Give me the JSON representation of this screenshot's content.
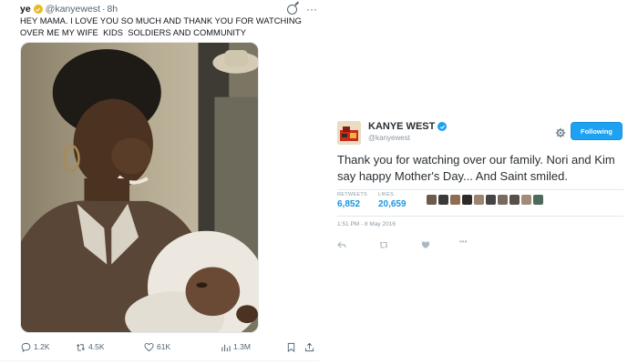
{
  "tweet": {
    "display_name": "ye",
    "handle": "@kanyewest",
    "separator": "·",
    "time": "8h",
    "more": "···",
    "text_line1": "HEY MAMA. I LOVE YOU SO MUCH AND THANK YOU FOR WATCHING",
    "text_line2": "OVER ME MY WIFE  KIDS  SOLDIERS AND COMMUNITY",
    "actions": {
      "replies": "1.2K",
      "reposts": "4.5K",
      "likes": "61K",
      "views": "1.3M"
    }
  },
  "embed": {
    "name": "KANYE WEST",
    "handle": "@kanyewest",
    "follow_label": "Following",
    "text": "Thank you for watching over our family. Nori and Kim say happy Mother's Day... And Saint smiled.",
    "retweets_label": "RETWEETS",
    "retweets_value": "6,852",
    "likes_label": "LIKES",
    "likes_value": "20,659",
    "timestamp": "1:51 PM - 8 May 2016",
    "more": "•••"
  },
  "colors": {
    "gold_badge": "#e8b923",
    "blue_badge": "#1da1f2",
    "link_blue": "#1b95e0"
  },
  "icons": [
    "gold-verified-icon",
    "grok-icon",
    "more-icon",
    "reply-icon",
    "repost-icon",
    "like-icon",
    "views-icon",
    "bookmark-icon",
    "share-icon",
    "blue-verified-icon",
    "gear-icon"
  ]
}
